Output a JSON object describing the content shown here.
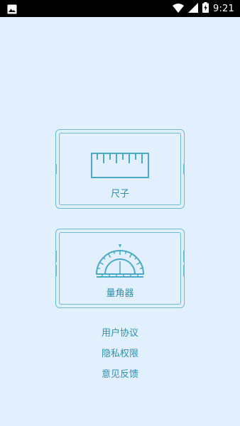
{
  "status_bar": {
    "time": "9:21",
    "icons": [
      "image-icon",
      "wifi-icon",
      "signal-icon",
      "battery-charging-icon"
    ]
  },
  "cards": {
    "ruler": {
      "label": "尺子",
      "icon": "ruler-icon"
    },
    "protractor": {
      "label": "量角器",
      "icon": "protractor-icon"
    }
  },
  "links": {
    "user_agreement": "用户协议",
    "privacy_policy": "隐私权限",
    "feedback": "意见反馈"
  },
  "colors": {
    "background": "#e1f0fc",
    "accent": "#6bbccf",
    "text": "#2e90ad"
  }
}
